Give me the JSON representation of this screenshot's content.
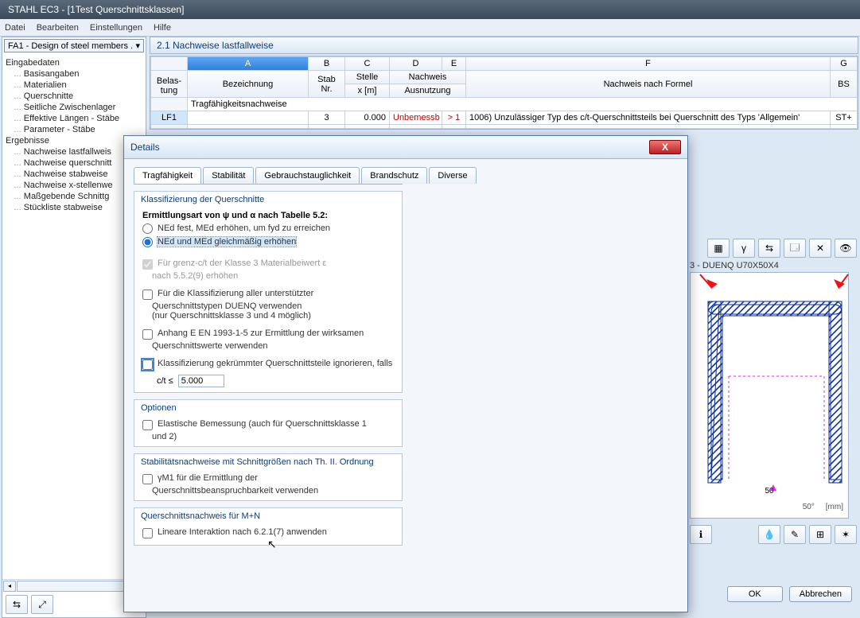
{
  "window": {
    "title": "STAHL EC3 - [1Test Querschnittsklassen]"
  },
  "menu": [
    "Datei",
    "Bearbeiten",
    "Einstellungen",
    "Hilfe"
  ],
  "sidebar": {
    "dropdown": "FA1 - Design of steel members .",
    "groups": [
      {
        "label": "Eingabedaten",
        "items": [
          "Basisangaben",
          "Materialien",
          "Querschnitte",
          "Seitliche Zwischenlager",
          "Effektive Längen - Stäbe",
          "Parameter - Stäbe"
        ]
      },
      {
        "label": "Ergebnisse",
        "items": [
          "Nachweise lastfallweis",
          "Nachweise querschnitt",
          "Nachweise stabweise",
          "Nachweise x-stellenwe",
          "Maßgebende Schnittg",
          "Stückliste stabweise"
        ]
      }
    ]
  },
  "section_title": "2.1 Nachweise lastfallweise",
  "grid": {
    "colLetters": [
      "A",
      "B",
      "C",
      "D",
      "E",
      "F",
      "G"
    ],
    "header1_merge": {
      "belastung": "Belas-",
      "stelle": "Stelle",
      "nachweis": "Nachweis"
    },
    "header2": {
      "belastung": "tung",
      "bez": "Bezeichnung",
      "stab": "Stab Nr.",
      "x": "x [m]",
      "ausn": "Ausnutzung",
      "formel": "Nachweis nach Formel",
      "bs": "BS"
    },
    "groupRow": "Tragfähigkeitsnachweise",
    "row": {
      "lf": "LF1",
      "bez": "",
      "stab": "3",
      "x": "0.000",
      "ausn1": "Unbemessb",
      "ausn2": "> 1",
      "formel": "1006) Unzulässiger Typ des c/t-Querschnittsteils bei Querschnitt des Typs 'Allgemein'",
      "bs": "ST+"
    }
  },
  "dialog": {
    "title": "Details",
    "tabs": [
      "Tragfähigkeit",
      "Stabilität",
      "Gebrauchstauglichkeit",
      "Brandschutz",
      "Diverse"
    ],
    "g1": {
      "title": "Klassifizierung der Querschnitte",
      "subtitle": "Ermittlungsart von ψ und α nach Tabelle 5.2:",
      "r1": "NEd fest, MEd erhöhen, um fyd zu erreichen",
      "r2": "NEd und MEd gleichmäßig erhöhen",
      "c1a": "Für grenz-c/t der Klasse 3 Materialbeiwert ε",
      "c1b": "nach 5.5.2(9) erhöhen",
      "c2a": "Für die Klassifizierung aller unterstützter",
      "c2b": "Querschnittstypen DUENQ verwenden",
      "c2c": "(nur Querschnittsklasse 3 und 4 möglich)",
      "c3a": "Anhang E EN 1993-1-5 zur Ermittlung der wirksamen",
      "c3b": "Querschnittswerte verwenden",
      "c4": "Klassifizierung gekrümmter Querschnittsteile ignorieren, falls",
      "ratio_label": "c/t ≤",
      "ratio_val": "5.000"
    },
    "g2": {
      "title": "Optionen",
      "c1a": "Elastische Bemessung (auch für Querschnittsklasse 1",
      "c1b": "und 2)"
    },
    "g3": {
      "title": "Stabilitätsnachweise mit Schnittgrößen nach Th. II. Ordnung",
      "c1a": "γM1 für die Ermittlung der",
      "c1b": "Querschnittsbeanspruchbarkeit verwenden"
    },
    "g4": {
      "title": "Querschnittsnachweis für M+N",
      "c1": "Lineare Interaktion nach 6.2.1(7) anwenden"
    }
  },
  "preview": {
    "title": "3 - DUENQ U70X50X4",
    "dim": "50",
    "axis": "50°",
    "unit": "[mm]"
  },
  "buttons": {
    "ok": "OK",
    "cancel": "Abbrechen"
  }
}
